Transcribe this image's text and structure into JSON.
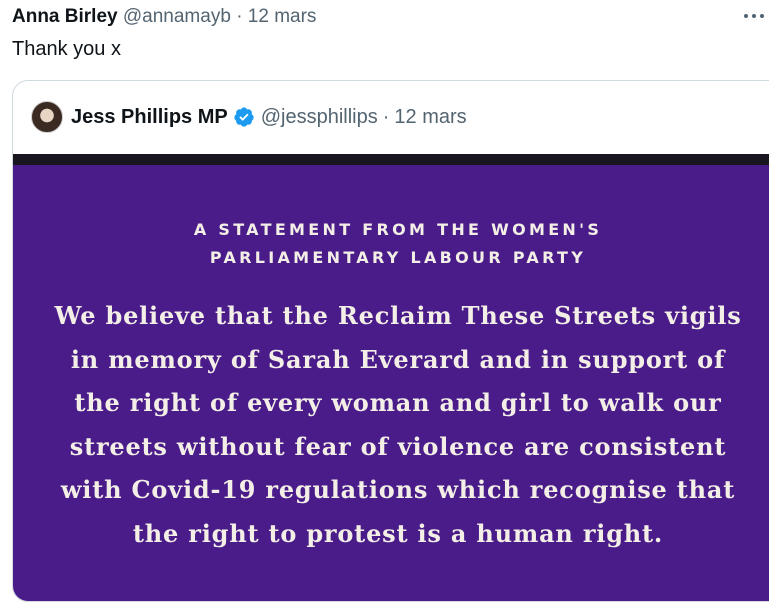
{
  "tweet": {
    "author_name": "Anna Birley",
    "handle": "@annamayb",
    "separator": "·",
    "date": "12 mars",
    "text": "Thank you x",
    "more_icon": "more-horizontal-icon"
  },
  "quoted_tweet": {
    "author_name": "Jess Phillips MP",
    "verified_icon": "verified-badge-icon",
    "handle": "@jessphillips",
    "separator": "·",
    "date": "12 mars",
    "media": {
      "background_color": "#4a1c8a",
      "heading_lines": [
        "A STATEMENT FROM THE WOMEN'S",
        "PARLIAMENTARY LABOUR PARTY"
      ],
      "body_lines": [
        "We believe that the Reclaim These Streets vigils",
        "in memory of Sarah Everard and in support of",
        "the right of every woman and girl to walk our",
        "streets without fear of violence are consistent",
        "with Covid-19 regulations which recognise that",
        "the right to protest is a human right."
      ]
    }
  },
  "colors": {
    "verified_blue": "#1d9bf0",
    "meta_gray": "#536471",
    "text_dark": "#0f1419",
    "card_border": "#cfd9de"
  }
}
